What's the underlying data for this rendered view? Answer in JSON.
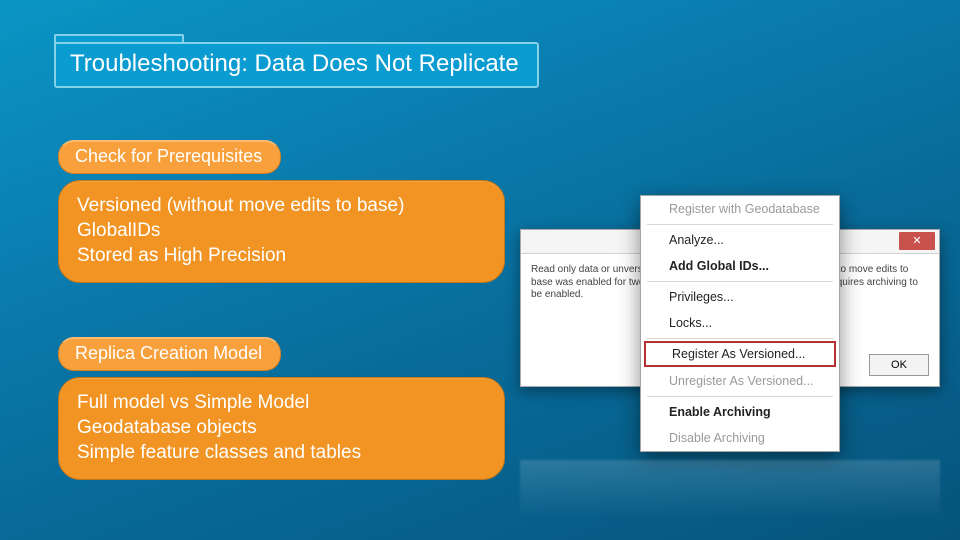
{
  "title": "Troubleshooting: Data Does Not Replicate",
  "section1": {
    "header": "Check for Prerequisites",
    "line1": "Versioned (without move edits to base)",
    "line2": "GlobalIDs",
    "line3": "Stored as High Precision"
  },
  "section2": {
    "header": "Replica Creation Model",
    "line1": "Full model vs Simple Model",
    "line2": "Geodatabase objects",
    "line3": "Simple feature classes and tables"
  },
  "dialog": {
    "close_glyph": "✕",
    "body_text": "Read only data or unversioned data cannot be replicated. The option to move edits to base was enabled for two way and one way replication. Versioning requires archiving to be enabled.",
    "ok_label": "OK"
  },
  "menu": {
    "item0": "Register with Geodatabase",
    "item1": "Analyze...",
    "item2": "Add Global IDs...",
    "item3": "Privileges...",
    "item4": "Locks...",
    "item5": "Register As Versioned...",
    "item6": "Unregister As Versioned...",
    "item7": "Enable Archiving",
    "item8": "Disable Archiving"
  }
}
